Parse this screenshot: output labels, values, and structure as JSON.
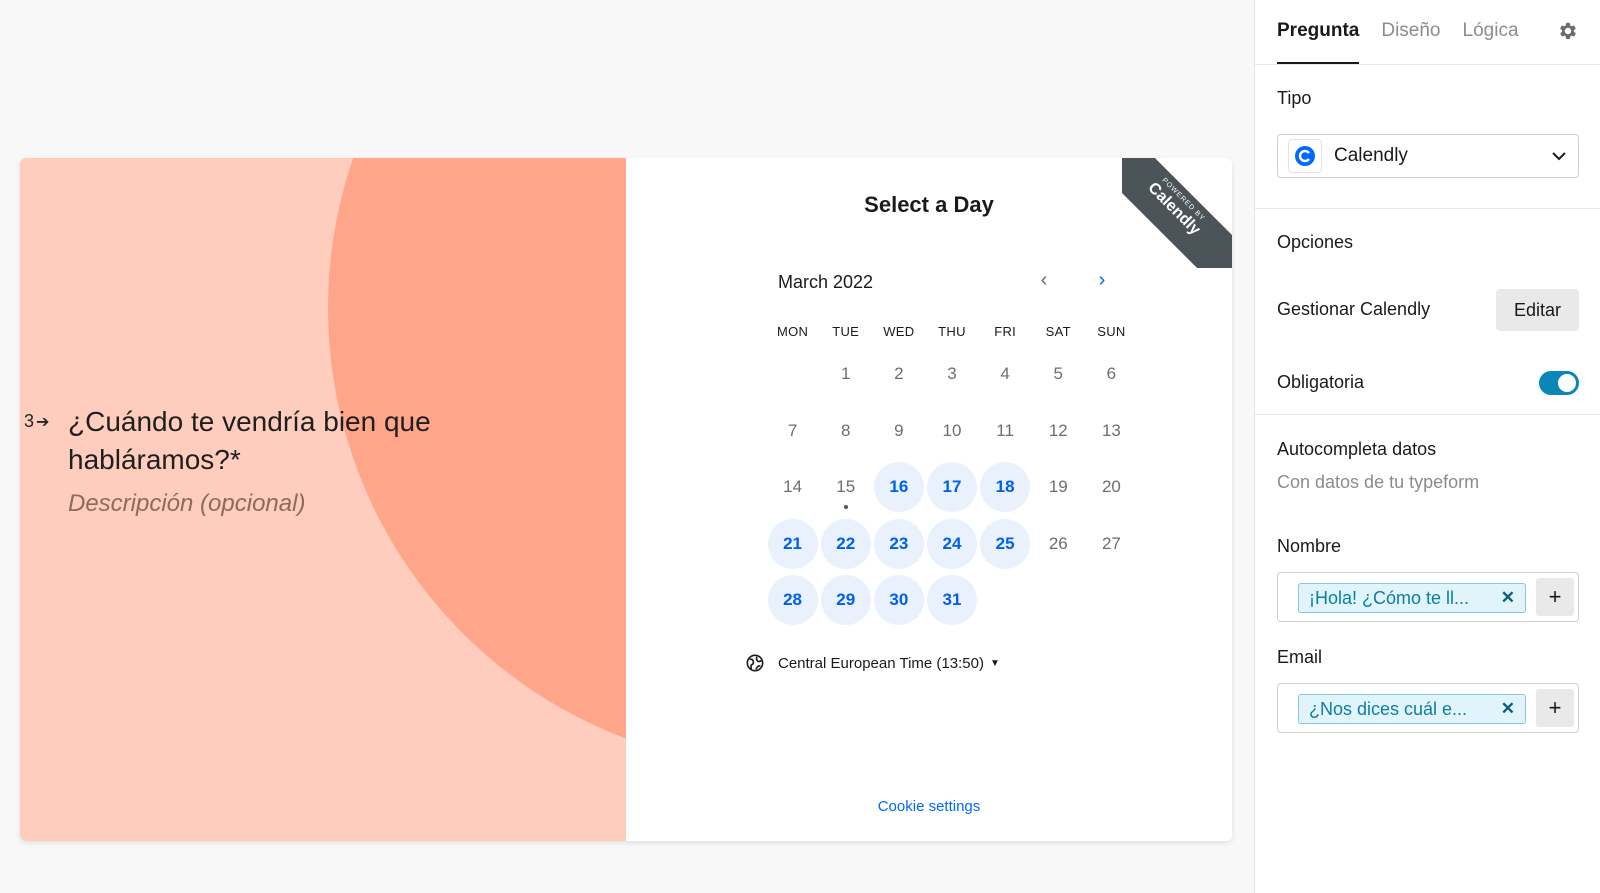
{
  "preview": {
    "question_number": "3",
    "question_title": "¿Cuándo te vendría bien que habláramos?*",
    "question_description": "Descripción (opcional)",
    "ribbon": {
      "small": "POWERED BY",
      "big": "Calendly"
    },
    "calendar": {
      "title": "Select a Day",
      "month": "March 2022",
      "weekdays": [
        "MON",
        "TUE",
        "WED",
        "THU",
        "FRI",
        "SAT",
        "SUN"
      ],
      "weeks": [
        [
          {
            "d": ""
          },
          {
            "d": "1"
          },
          {
            "d": "2"
          },
          {
            "d": "3"
          },
          {
            "d": "4"
          },
          {
            "d": "5"
          },
          {
            "d": "6"
          }
        ],
        [
          {
            "d": "7"
          },
          {
            "d": "8"
          },
          {
            "d": "9"
          },
          {
            "d": "10"
          },
          {
            "d": "11"
          },
          {
            "d": "12"
          },
          {
            "d": "13"
          }
        ],
        [
          {
            "d": "14"
          },
          {
            "d": "15",
            "today": true
          },
          {
            "d": "16",
            "available": true
          },
          {
            "d": "17",
            "available": true
          },
          {
            "d": "18",
            "available": true
          },
          {
            "d": "19"
          },
          {
            "d": "20"
          }
        ],
        [
          {
            "d": "21",
            "available": true
          },
          {
            "d": "22",
            "available": true
          },
          {
            "d": "23",
            "available": true
          },
          {
            "d": "24",
            "available": true
          },
          {
            "d": "25",
            "available": true
          },
          {
            "d": "26"
          },
          {
            "d": "27"
          }
        ],
        [
          {
            "d": "28",
            "available": true
          },
          {
            "d": "29",
            "available": true
          },
          {
            "d": "30",
            "available": true
          },
          {
            "d": "31",
            "available": true
          },
          {
            "d": ""
          },
          {
            "d": ""
          },
          {
            "d": ""
          }
        ]
      ],
      "timezone": "Central European Time (13:50)",
      "cookie_link": "Cookie settings"
    },
    "colors": {
      "background": "#ffcdbd",
      "shape": "#ffa68a",
      "accent": "#0069ff"
    }
  },
  "sidebar": {
    "tabs": [
      "Pregunta",
      "Diseño",
      "Lógica"
    ],
    "active_tab": "Pregunta",
    "type_label": "Tipo",
    "type_value": "Calendly",
    "options_label": "Opciones",
    "manage_label": "Gestionar Calendly",
    "edit_button": "Editar",
    "required_label": "Obligatoria",
    "required_on": true,
    "autofill_label": "Autocompleta datos",
    "autofill_sub": "Con datos de tu typeform",
    "name_label": "Nombre",
    "name_chip": "¡Hola! ¿Cómo te ll...",
    "email_label": "Email",
    "email_chip": "¿Nos dices cuál e...",
    "toggle_color": "#0a86b8"
  }
}
